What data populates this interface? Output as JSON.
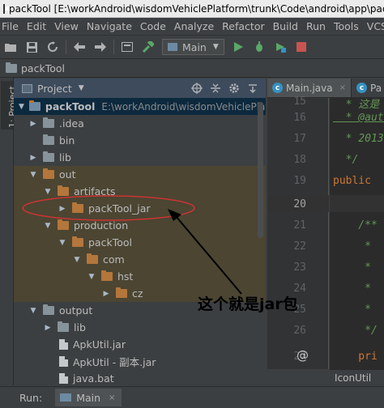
{
  "title_bar": {
    "text": "packTool [E:\\workAndroid\\wisdomVehiclePlatform\\trunk\\Code\\android\\app\\packTool"
  },
  "menu": [
    "File",
    "Edit",
    "View",
    "Navigate",
    "Code",
    "Analyze",
    "Refactor",
    "Build",
    "Run",
    "Tools",
    "VCS"
  ],
  "toolbar": {
    "run_config": "Main",
    "icons": [
      "save-icon",
      "save-all-icon",
      "sync-icon",
      "back-icon",
      "forward-icon",
      "structure-icon",
      "build-hammer-icon",
      "run-icon",
      "debug-icon",
      "coverage-icon",
      "stop-icon"
    ]
  },
  "breadcrumb": {
    "project": "packTool"
  },
  "side_strip": {
    "label": "1: Project"
  },
  "project_panel": {
    "title": "Project",
    "tree": [
      {
        "label": "packTool",
        "path": "E:\\workAndroid\\wisdomVehiclePlatfo",
        "arrow": "▼",
        "icon": "module"
      },
      {
        "label": ".idea",
        "arrow": "▶",
        "icon": "gray"
      },
      {
        "label": "bin",
        "arrow": "",
        "icon": "gray"
      },
      {
        "label": "lib",
        "arrow": "▶",
        "icon": "gray"
      },
      {
        "label": "out",
        "arrow": "▼",
        "icon": "orange"
      },
      {
        "label": "artifacts",
        "arrow": "▼",
        "icon": "orange"
      },
      {
        "label": "packTool_jar",
        "arrow": "▶",
        "icon": "orange"
      },
      {
        "label": "production",
        "arrow": "▼",
        "icon": "orange"
      },
      {
        "label": "packTool",
        "arrow": "▼",
        "icon": "orange"
      },
      {
        "label": "com",
        "arrow": "▼",
        "icon": "orange"
      },
      {
        "label": "hst",
        "arrow": "▼",
        "icon": "orange"
      },
      {
        "label": "cz",
        "arrow": "▶",
        "icon": "orange"
      },
      {
        "label": "output",
        "arrow": "▼",
        "icon": "gray"
      },
      {
        "label": "lib",
        "arrow": "▶",
        "icon": "gray"
      },
      {
        "label": "ApkUtil.jar",
        "arrow": "",
        "icon": "file"
      },
      {
        "label": "ApkUtil - 副本.jar",
        "arrow": "",
        "icon": "file"
      },
      {
        "label": "java.bat",
        "arrow": "",
        "icon": "file"
      }
    ]
  },
  "editor": {
    "tabs": [
      {
        "label": "Main.java",
        "close": "×"
      },
      {
        "label": "Pa"
      }
    ],
    "line_numbers": [
      "15",
      "16",
      "17",
      "18",
      "19",
      "20",
      "21",
      "22",
      "23",
      "24",
      "25",
      "26",
      "27"
    ],
    "code_lines": [
      "  * 这是",
      "  * @auth",
      "  * 2013",
      "  */",
      "public ",
      "",
      "    /**",
      "     *",
      "     *",
      "     *",
      "     *",
      "     */",
      "    pri"
    ],
    "footer_label": "IconUtil"
  },
  "run_bar": {
    "label": "Run:",
    "tab": "Main",
    "close": "×"
  },
  "annotation": {
    "text": "这个就是jar包",
    "color": "#cc3333"
  }
}
